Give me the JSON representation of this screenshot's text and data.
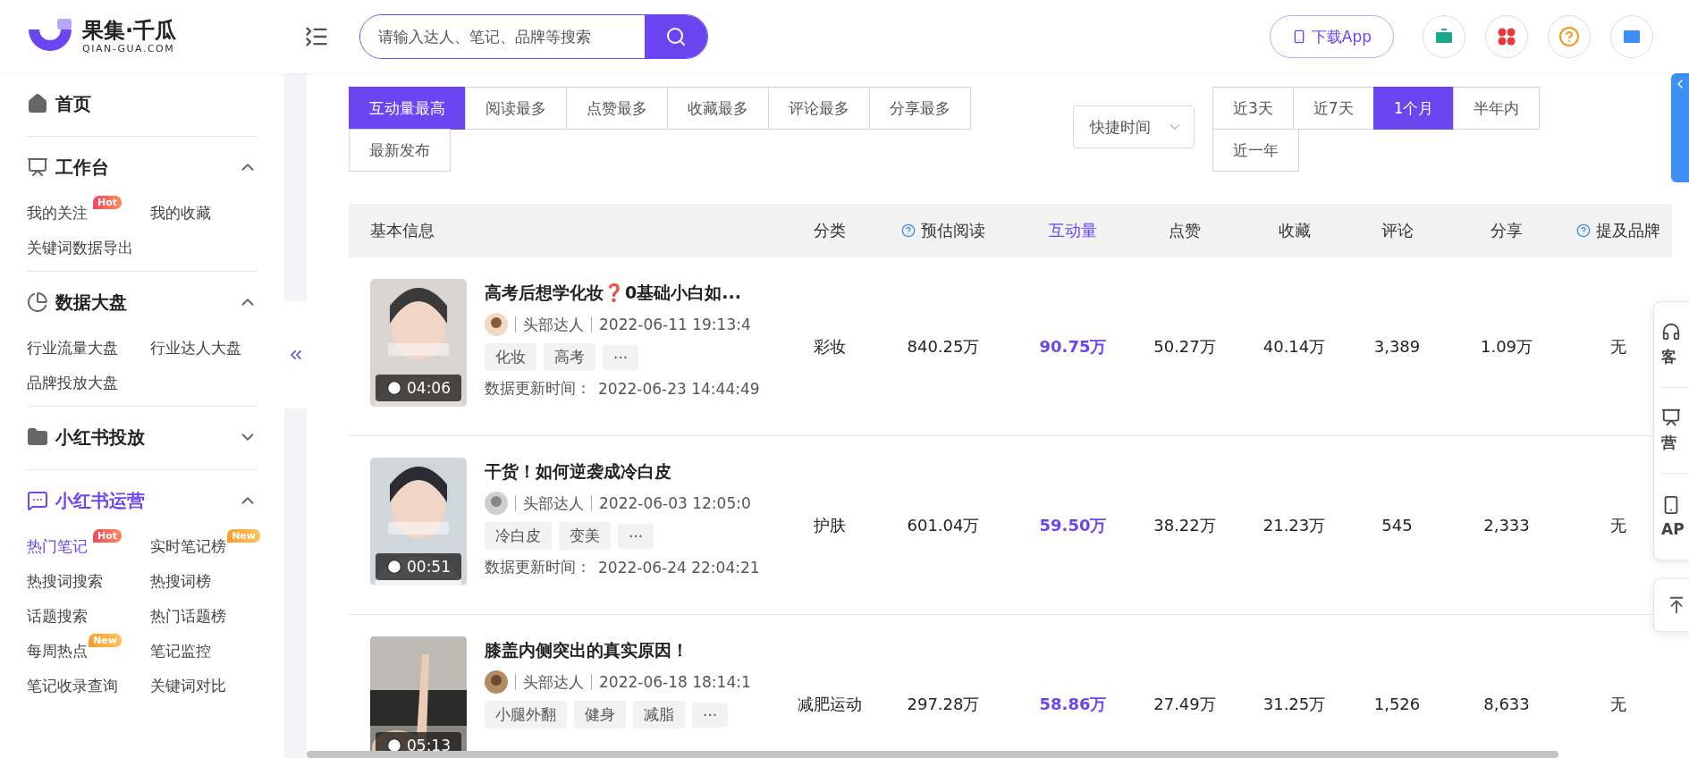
{
  "header": {
    "logo_name": "果集·千瓜",
    "logo_domain": "QIAN-GUA.COM",
    "search": {
      "placeholder": "请输入达人、笔记、品牌等搜索"
    },
    "download_button": "下载App"
  },
  "sidebar": {
    "home": "首页",
    "sections": [
      {
        "title": "工作台",
        "kind": "dashboard",
        "expanded": true,
        "active": false,
        "items": [
          {
            "label": "我的关注",
            "badge": {
              "text": "Hot",
              "kind": "hot"
            },
            "selected": false
          },
          {
            "label": "我的收藏",
            "selected": false
          },
          {
            "label": "关键词数据导出",
            "selected": false
          }
        ]
      },
      {
        "title": "数据大盘",
        "kind": "pie",
        "expanded": true,
        "active": false,
        "items": [
          {
            "label": "行业流量大盘",
            "selected": false
          },
          {
            "label": "行业达人大盘",
            "selected": false
          },
          {
            "label": "品牌投放大盘",
            "selected": false
          }
        ]
      },
      {
        "title": "小红书投放",
        "kind": "folder",
        "expanded": false,
        "active": false
      },
      {
        "title": "小红书运营",
        "kind": "trend",
        "expanded": true,
        "active": true,
        "items": [
          {
            "label": "热门笔记",
            "badge": {
              "text": "Hot",
              "kind": "hot"
            },
            "selected": true
          },
          {
            "label": "实时笔记榜",
            "badge": {
              "text": "New",
              "kind": "new"
            },
            "selected": false
          },
          {
            "label": "热搜词搜索",
            "selected": false
          },
          {
            "label": "热搜词榜",
            "selected": false
          },
          {
            "label": "话题搜索",
            "selected": false
          },
          {
            "label": "热门话题榜",
            "selected": false
          },
          {
            "label": "每周热点",
            "badge": {
              "text": "New",
              "kind": "new"
            },
            "selected": false
          },
          {
            "label": "笔记监控",
            "selected": false
          },
          {
            "label": "笔记收录查询",
            "selected": false
          },
          {
            "label": "关键词对比",
            "selected": false
          }
        ]
      }
    ]
  },
  "sort_tabs": [
    {
      "label": "互动量最高",
      "selected": true
    },
    {
      "label": "阅读最多",
      "selected": false
    },
    {
      "label": "点赞最多",
      "selected": false
    },
    {
      "label": "收藏最多",
      "selected": false
    },
    {
      "label": "评论最多",
      "selected": false
    },
    {
      "label": "分享最多",
      "selected": false
    },
    {
      "label": "最新发布",
      "selected": false
    }
  ],
  "time_select": {
    "placeholder": "快捷时间"
  },
  "time_tabs": [
    {
      "label": "近3天",
      "selected": false
    },
    {
      "label": "近7天",
      "selected": false
    },
    {
      "label": "1个月",
      "selected": true
    },
    {
      "label": "半年内",
      "selected": false
    },
    {
      "label": "近一年",
      "selected": false
    }
  ],
  "table": {
    "info_header": "基本信息",
    "columns": [
      {
        "label": "分类",
        "help": false,
        "selected": false
      },
      {
        "label": "预估阅读",
        "help": true,
        "selected": false
      },
      {
        "label": "互动量",
        "help": false,
        "selected": true
      },
      {
        "label": "点赞",
        "help": false,
        "selected": false
      },
      {
        "label": "收藏",
        "help": false,
        "selected": false
      },
      {
        "label": "评论",
        "help": false,
        "selected": false
      },
      {
        "label": "分享",
        "help": false,
        "selected": false
      },
      {
        "label": "提及品牌",
        "help": true,
        "selected": false
      }
    ],
    "rows": [
      {
        "title": "高考后想学化妆❓0基础小白如...",
        "author_type": "头部达人",
        "published": "2022-06-11 19:13:4",
        "tags": [
          "化妆",
          "高考"
        ],
        "more": "···",
        "updated_label": "数据更新时间：",
        "updated": "2022-06-23 14:44:49",
        "duration": "04:06",
        "cells": [
          "彩妆",
          "840.25万",
          "90.75万",
          "50.27万",
          "40.14万",
          "3,389",
          "1.09万",
          "无"
        ]
      },
      {
        "title": "干货！如何逆袭成冷白皮",
        "author_type": "头部达人",
        "published": "2022-06-03 12:05:0",
        "tags": [
          "冷白皮",
          "变美"
        ],
        "more": "···",
        "updated_label": "数据更新时间：",
        "updated": "2022-06-24 22:04:21",
        "duration": "00:51",
        "cells": [
          "护肤",
          "601.04万",
          "59.50万",
          "38.22万",
          "21.23万",
          "545",
          "2,333",
          "无"
        ]
      },
      {
        "title": "膝盖内侧突出的真实原因！",
        "author_type": "头部达人",
        "published": "2022-06-18 18:14:1",
        "tags": [
          "小腿外翻",
          "健身",
          "减脂"
        ],
        "more": "···",
        "duration": "05:13",
        "cells": [
          "减肥运动",
          "297.28万",
          "58.86万",
          "27.49万",
          "31.25万",
          "1,526",
          "8,633",
          "无"
        ]
      }
    ]
  },
  "float_panel": [
    {
      "label": "客",
      "kind": "service"
    },
    {
      "label": "营",
      "kind": "marketing"
    },
    {
      "label": "AP",
      "kind": "app"
    }
  ]
}
